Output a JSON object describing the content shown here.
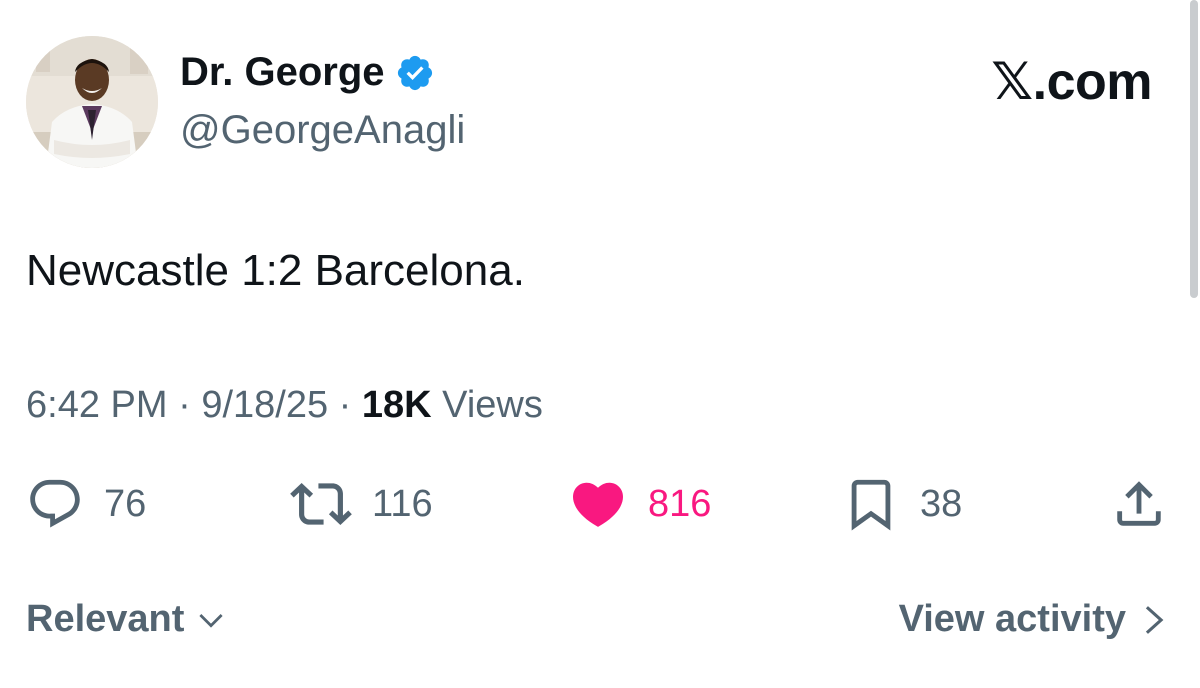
{
  "author": {
    "display_name": "Dr. George",
    "handle": "@GeorgeAnagli",
    "verified": true
  },
  "brand": "𝕏.com",
  "tweet": {
    "text": "Newcastle 1:2 Barcelona.",
    "time": "6:42 PM",
    "separator": "·",
    "date": "9/18/25",
    "views_count": "18K",
    "views_label": "Views"
  },
  "actions": {
    "replies": "76",
    "reposts": "116",
    "likes": "816",
    "bookmarks": "38"
  },
  "footer": {
    "sort_label": "Relevant",
    "activity_label": "View activity"
  },
  "colors": {
    "verified_blue": "#1d9bf0",
    "like_pink": "#f91880",
    "muted_gray": "#536471",
    "text_black": "#0f1419"
  },
  "icons": {
    "reply": "speech-bubble-icon",
    "repost": "repost-arrows-icon",
    "like": "heart-icon",
    "bookmark": "bookmark-icon",
    "share": "share-upload-icon",
    "verified": "verified-badge-icon"
  }
}
